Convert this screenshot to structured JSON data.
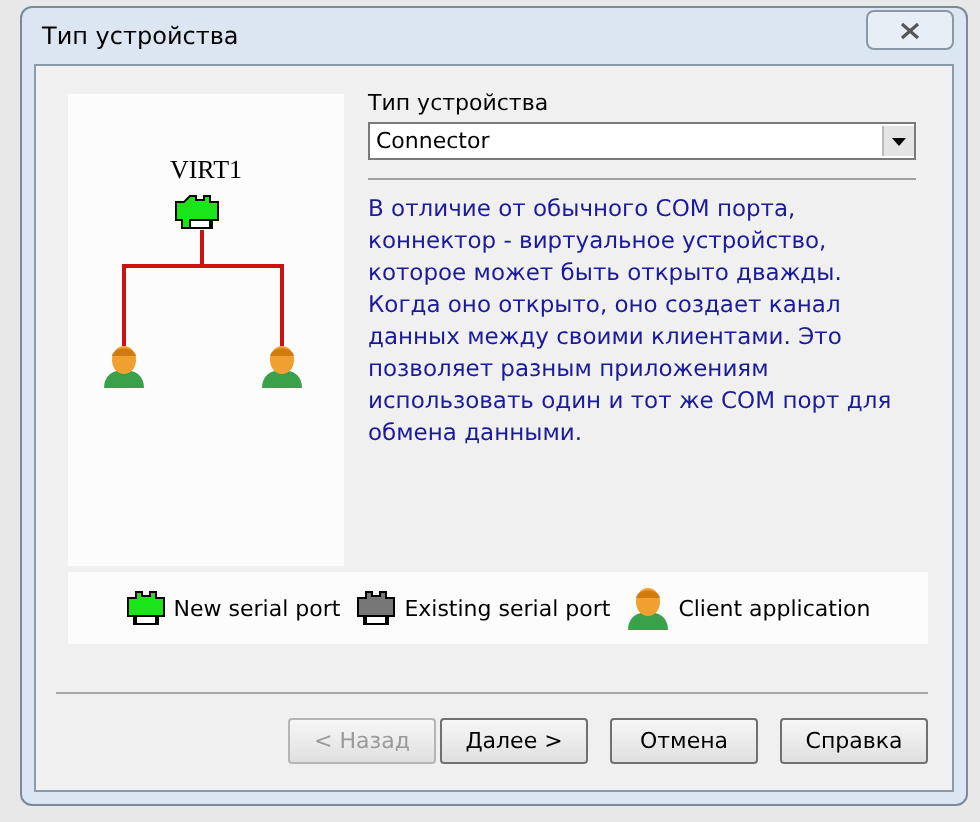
{
  "window": {
    "title": "Тип устройства"
  },
  "diagram": {
    "device_label": "VIRT1"
  },
  "device_type": {
    "label": "Тип устройства",
    "value": "Connector"
  },
  "description": "В отличие от обычного COM порта, коннектор - виртуальное устройство, которое может быть открыто дважды. Когда оно открыто, оно создает канал данных между своими клиентами. Это позволяет разным приложениям использовать один и тот же COM порт для обмена данными.",
  "legend": [
    {
      "kind": "new_port",
      "label": "New serial port"
    },
    {
      "kind": "existing_port",
      "label": "Existing serial port"
    },
    {
      "kind": "client",
      "label": "Client application"
    }
  ],
  "buttons": [
    {
      "label": "< Назад",
      "disabled": true
    },
    {
      "label": "Далее >",
      "disabled": false
    },
    {
      "label": "Отмена",
      "disabled": false
    },
    {
      "label": "Справка",
      "disabled": false
    }
  ]
}
